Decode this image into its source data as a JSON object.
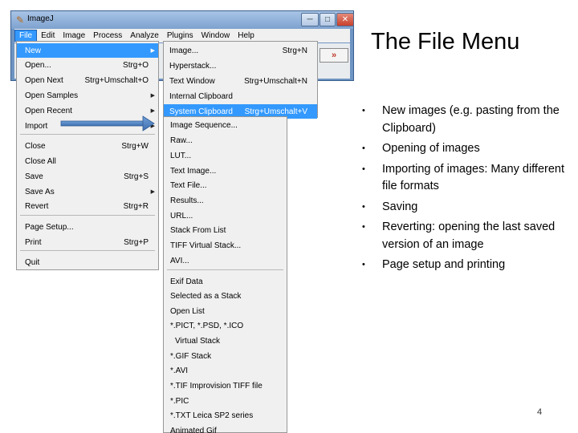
{
  "window": {
    "title": "ImageJ",
    "app_icon": "imagej-icon",
    "controls": {
      "minimize": "─",
      "maximize": "□",
      "close": "✕"
    },
    "menubar": [
      "File",
      "Edit",
      "Image",
      "Process",
      "Analyze",
      "Plugins",
      "Window",
      "Help"
    ],
    "toolbar_more": "»"
  },
  "file_menu": [
    {
      "label": "New",
      "shortcut": "",
      "submenu": true,
      "highlighted": true
    },
    {
      "label": "Open...",
      "shortcut": "Strg+O",
      "submenu": false
    },
    {
      "label": "Open Next",
      "shortcut": "Strg+Umschalt+O",
      "submenu": false
    },
    {
      "label": "Open Samples",
      "shortcut": "",
      "submenu": true
    },
    {
      "label": "Open Recent",
      "shortcut": "",
      "submenu": true
    },
    {
      "label": "Import",
      "shortcut": "",
      "submenu": true
    },
    {
      "label": "Close",
      "shortcut": "Strg+W",
      "submenu": false
    },
    {
      "label": "Close All",
      "shortcut": "",
      "submenu": false
    },
    {
      "label": "Save",
      "shortcut": "Strg+S",
      "submenu": false
    },
    {
      "label": "Save As",
      "shortcut": "",
      "submenu": true
    },
    {
      "label": "Revert",
      "shortcut": "Strg+R",
      "submenu": false
    },
    {
      "label": "Page Setup...",
      "shortcut": "",
      "submenu": false
    },
    {
      "label": "Print",
      "shortcut": "Strg+P",
      "submenu": false
    },
    {
      "label": "Quit",
      "shortcut": "",
      "submenu": false
    }
  ],
  "new_menu": [
    {
      "label": "Image...",
      "shortcut": "Strg+N"
    },
    {
      "label": "Hyperstack...",
      "shortcut": ""
    },
    {
      "label": "Text Window",
      "shortcut": "Strg+Umschalt+N"
    },
    {
      "label": "Internal Clipboard",
      "shortcut": ""
    },
    {
      "label": "System Clipboard",
      "shortcut": "Strg+Umschalt+V",
      "highlighted": true
    }
  ],
  "import_menu": [
    "Image Sequence...",
    "Raw...",
    "LUT...",
    "Text Image...",
    "Text File...",
    "Results...",
    "URL...",
    "Stack From List",
    "TIFF Virtual Stack...",
    "AVI...",
    "Exif Data",
    "Selected as a Stack",
    "Open List",
    "*.PICT, *.PSD, *.ICO",
    "Virtual Stack",
    "*.GIF Stack",
    "*.AVI",
    "*.TIF Improvision TIFF file",
    "*.PIC",
    "*.TXT Leica SP2 series",
    "Animated Gif"
  ],
  "slide": {
    "title": "The File Menu",
    "bullets": [
      "New images (e.g. pasting from the Clipboard)",
      "Opening of images",
      "Importing of images: Many different file formats",
      "Saving",
      "Reverting: opening the last saved version of an image",
      "Page setup and printing"
    ],
    "bullet_symbol": "•",
    "page_number": "4"
  },
  "colors": {
    "highlight": "#3399ff",
    "window_frame": "#6e94c2",
    "arrow": "#4a7fc1"
  }
}
